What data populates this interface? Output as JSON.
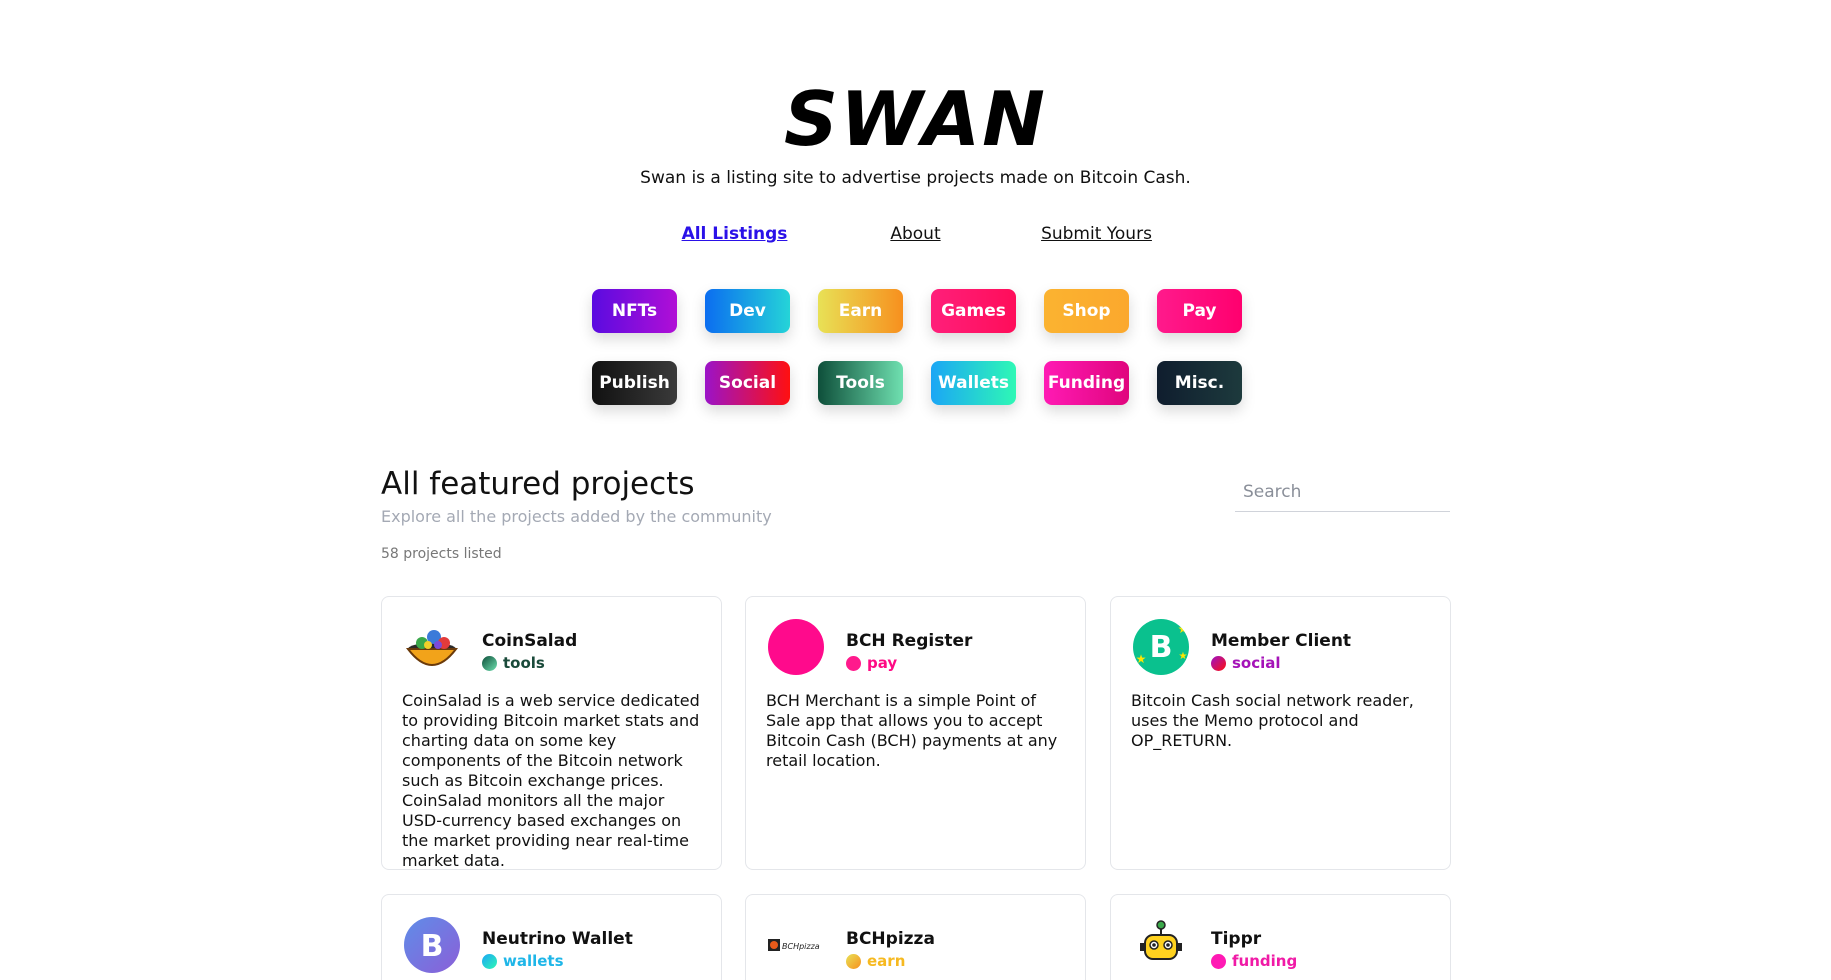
{
  "brand": {
    "logo": "SWAN",
    "tagline": "Swan is a listing site to advertise projects made on Bitcoin Cash."
  },
  "nav": [
    {
      "label": "All Listings",
      "active": true
    },
    {
      "label": "About",
      "active": false
    },
    {
      "label": "Submit Yours",
      "active": false
    }
  ],
  "categories": [
    {
      "label": "NFTs",
      "from": "#5a0be0",
      "to": "#b10fd6"
    },
    {
      "label": "Dev",
      "from": "#0b6df0",
      "to": "#25d4d8"
    },
    {
      "label": "Earn",
      "from": "#e8e156",
      "to": "#f7901e"
    },
    {
      "label": "Games",
      "from": "#ff1f7a",
      "to": "#ff0d5a"
    },
    {
      "label": "Shop",
      "from": "#fbb330",
      "to": "#fba82d"
    },
    {
      "label": "Pay",
      "from": "#ff1a8c",
      "to": "#ff006e"
    },
    {
      "label": "Publish",
      "from": "#111111",
      "to": "#3a3a3a"
    },
    {
      "label": "Social",
      "from": "#9b13c8",
      "to": "#ff1010"
    },
    {
      "label": "Tools",
      "from": "#0e4f3a",
      "to": "#6fe0b0"
    },
    {
      "label": "Wallets",
      "from": "#1ba6f5",
      "to": "#2ef8b5"
    },
    {
      "label": "Funding",
      "from": "#ff1ab4",
      "to": "#e0057d"
    },
    {
      "label": "Misc.",
      "from": "#0f1d2e",
      "to": "#1d3a3d"
    }
  ],
  "section": {
    "title": "All featured projects",
    "subtitle": "Explore all the projects added by the community",
    "count": "58 projects listed"
  },
  "search": {
    "placeholder": "Search"
  },
  "projects": [
    {
      "name": "CoinSalad",
      "tag": "tools",
      "tag_color": "#0e5f45",
      "tag_text": "#1a4a3a",
      "description": "CoinSalad is a web service dedicated to providing Bitcoin market stats and charting data on some key components of the Bitcoin network such as Bitcoin exchange prices. CoinSalad monitors all the major USD-currency based exchanges on the market providing near real-time market data.",
      "icon": "salad-bowl-icon"
    },
    {
      "name": "BCH Register",
      "tag": "pay",
      "tag_color": "#ff1a8c",
      "tag_text": "#ff0a84",
      "description": "BCH Merchant is a simple Point of Sale app that allows you to accept Bitcoin Cash (BCH) payments at any retail location.",
      "icon": "pink-circle-icon"
    },
    {
      "name": "Member Client",
      "tag": "social",
      "tag_color": "#c4126e",
      "tag_text": "#a513b8",
      "description": "Bitcoin Cash social network reader, uses the Memo protocol and OP_RETURN.",
      "icon": "bitcoin-cash-icon"
    },
    {
      "name": "Neutrino Wallet",
      "tag": "wallets",
      "tag_color": "#20d1c8",
      "tag_text": "#1fb6e8",
      "description": "",
      "icon": "bitcoin-b-icon"
    },
    {
      "name": "BCHpizza",
      "tag": "earn",
      "tag_color": "#f5c21a",
      "tag_text": "#f6b920",
      "description": "",
      "icon": "bchpizza-logo-icon"
    },
    {
      "name": "Tippr",
      "tag": "funding",
      "tag_color": "#ff1ab4",
      "tag_text": "#f01aa6",
      "description": "",
      "icon": "robot-icon"
    }
  ]
}
